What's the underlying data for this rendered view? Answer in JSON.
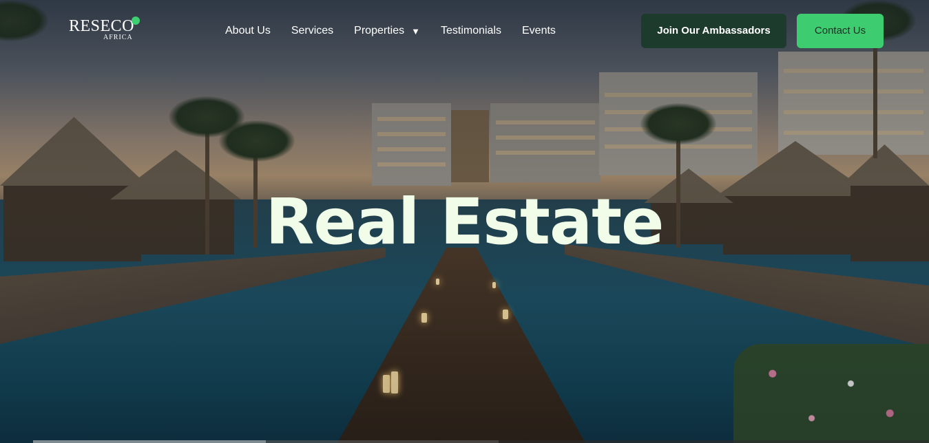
{
  "brand": {
    "name": "RESECO",
    "subname": "AFRICA",
    "accent": "#3ecf72"
  },
  "nav": {
    "items": [
      {
        "label": "About Us"
      },
      {
        "label": "Services"
      },
      {
        "label": "Properties",
        "caret": "▼"
      },
      {
        "label": "Testimonials"
      },
      {
        "label": "Events"
      }
    ]
  },
  "actions": {
    "ambassadors_label": "Join Our Ambassadors",
    "ambassadors_color": "#1d3b2c",
    "contact_label": "Contact Us",
    "contact_color": "#3ecc71"
  },
  "hero": {
    "headline": "Real Estate",
    "headline_color": "#f1fce9",
    "background": "resort-pool-at-dusk-image"
  }
}
